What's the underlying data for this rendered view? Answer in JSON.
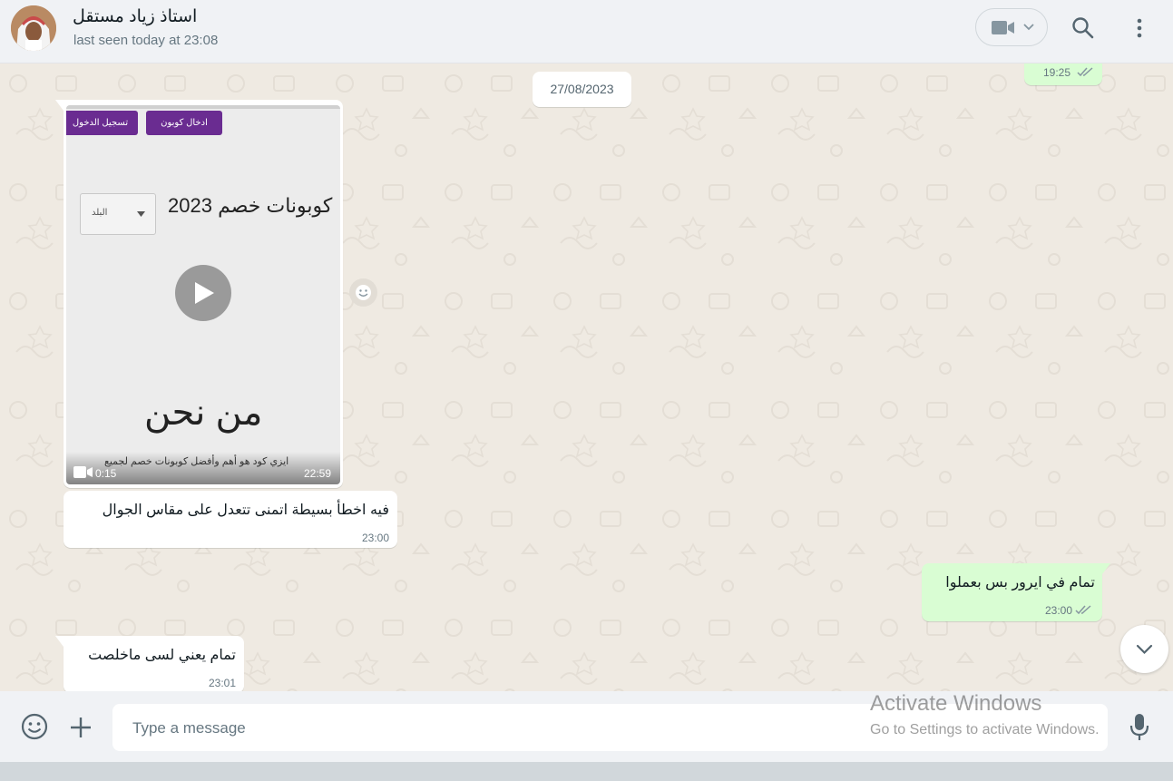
{
  "header": {
    "contact_name": "استاذ زياد مستقل",
    "last_seen": "last seen today at 23:08",
    "icons": [
      "video-call-icon",
      "chevron-down-icon",
      "search-icon",
      "menu-icon"
    ]
  },
  "chat": {
    "top_partial_time": "19:25",
    "date_chip": "27/08/2023",
    "video_message": {
      "duration": "0:15",
      "time": "22:59",
      "thumbnail": {
        "btn_login": "تسجيل الدخول",
        "btn_coupon": "ادخال كوبون",
        "title": "كوبونات خصم 2023",
        "dropdown": "البلد",
        "heading": "من نحن",
        "body_text": "ايزي كود هو أهم وأفضل كوبونات خصم لجميع"
      }
    },
    "messages": [
      {
        "direction": "in",
        "text": "فيه اخطأ بسيطة اتمنى تتعدل على مقاس الجوال",
        "time": "23:00"
      },
      {
        "direction": "out",
        "text": "تمام في ايرور بس بعملوا",
        "time": "23:00"
      },
      {
        "direction": "in",
        "text": "تمام يعني لسى ماخلصت",
        "time": "23:01"
      }
    ]
  },
  "composer": {
    "placeholder": "Type a message",
    "icons": [
      "emoji-icon",
      "attach-plus-icon",
      "microphone-icon"
    ]
  },
  "watermark": {
    "title": "Activate Windows",
    "subtitle": "Go to Settings to activate Windows."
  },
  "colors": {
    "outgoing_bubble": "#d9fdd3",
    "incoming_bubble": "#ffffff",
    "chat_background": "#efeae2",
    "header_background": "#f0f2f5",
    "thumbnail_button": "#6a2c91"
  }
}
